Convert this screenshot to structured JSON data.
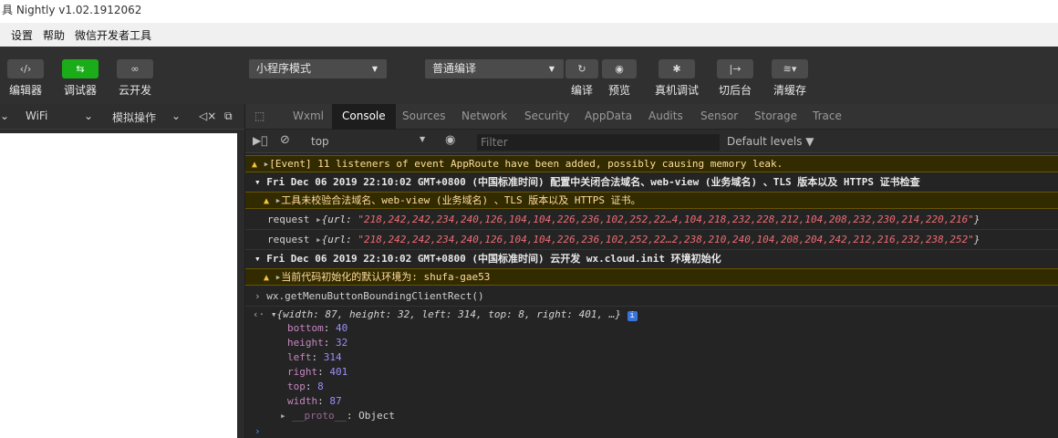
{
  "window": {
    "title": "具 Nightly v1.02.1912062"
  },
  "menu": {
    "items": [
      "设置",
      "帮助",
      "微信开发者工具"
    ]
  },
  "toolbar": {
    "editor": "编辑器",
    "debugger": "调试器",
    "cloud": "云开发",
    "mode_select": "小程序模式",
    "compile_select": "普通编译",
    "compile": "编译",
    "preview": "预览",
    "device_debug": "真机调试",
    "background": "切后台",
    "clear_cache": "清缓存"
  },
  "subbar": {
    "network": "WiFi",
    "simulate": "模拟操作"
  },
  "devtools": {
    "tabs": [
      "Wxml",
      "Console",
      "Sources",
      "Network",
      "Security",
      "AppData",
      "Audits",
      "Sensor",
      "Storage",
      "Trace"
    ],
    "active_tab": "Console",
    "context": "top",
    "filter_placeholder": "Filter",
    "levels": "Default levels ▼"
  },
  "console": {
    "line1": "[Event] 11 listeners of event AppRoute have been added, possibly causing memory leak.",
    "group1": "Fri Dec 06 2019 22:10:02 GMT+0800 (中国标准时间) 配置中关闭合法域名、web-view (业务域名) 、TLS 版本以及 HTTPS 证书检查",
    "group1_warn": "工具未校验合法域名、web-view (业务域名) 、TLS 版本以及 HTTPS 证书。",
    "req_label": "request",
    "req1_key": "url: ",
    "req1_val": "\"218,242,242,234,240,126,104,104,226,236,102,252,22…4,104,218,232,228,212,104,208,232,230,214,220,216\"",
    "req2_val": "\"218,242,242,234,240,126,104,104,226,236,102,252,22…2,238,210,240,104,208,204,242,212,216,232,238,252\"",
    "group2": "Fri Dec 06 2019 22:10:02 GMT+0800 (中国标准时间) 云开发 wx.cloud.init 环境初始化",
    "group2_warn": "当前代码初始化的默认环境为: shufa-gae53",
    "cmd": "wx.getMenuButtonBoundingClientRect()",
    "result_summary": "{width: 87, height: 32, left: 314, top: 8, right: 401, …}",
    "props": [
      {
        "key": "bottom",
        "value": "40"
      },
      {
        "key": "height",
        "value": "32"
      },
      {
        "key": "left",
        "value": "314"
      },
      {
        "key": "right",
        "value": "401"
      },
      {
        "key": "top",
        "value": "8"
      },
      {
        "key": "width",
        "value": "87"
      }
    ],
    "proto_key": "__proto__",
    "proto_value": "Object"
  }
}
